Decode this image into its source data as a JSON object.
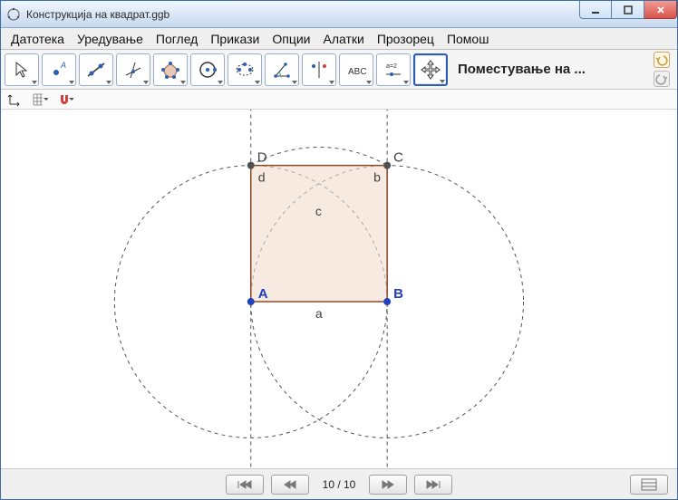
{
  "window": {
    "title": "Конструкција на квадрат.ggb"
  },
  "menu": {
    "items": [
      "Датотека",
      "Уредување",
      "Поглед",
      "Прикази",
      "Опции",
      "Алатки",
      "Прозорец",
      "Помош"
    ]
  },
  "toolbar": {
    "selected_tool_label": "Поместување на ..."
  },
  "nav": {
    "step_counter": "10 / 10"
  },
  "geometry": {
    "points": {
      "A": "A",
      "B": "B",
      "C": "C",
      "D": "D"
    },
    "sides": {
      "a": "a",
      "b": "b",
      "c": "c",
      "d": "d"
    }
  }
}
